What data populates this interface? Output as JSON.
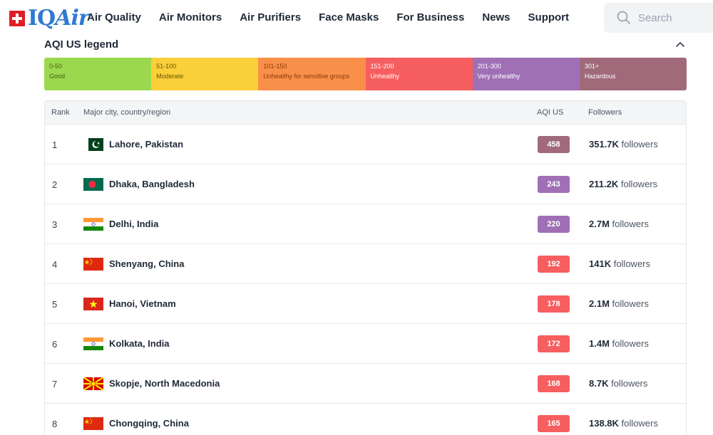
{
  "brand": {
    "name": "IQAir",
    "name_plain": "IQ",
    "name_italic": "Air"
  },
  "nav": [
    {
      "label": "Air Quality"
    },
    {
      "label": "Air Monitors"
    },
    {
      "label": "Air Purifiers"
    },
    {
      "label": "Face Masks"
    },
    {
      "label": "For Business"
    },
    {
      "label": "News"
    },
    {
      "label": "Support"
    }
  ],
  "search": {
    "placeholder": "Search"
  },
  "legend": {
    "title": "AQI US legend",
    "segments": [
      {
        "range": "0-50",
        "label": "Good",
        "color": "#9cd84e",
        "text_color": "#3f5d12"
      },
      {
        "range": "51-100",
        "label": "Moderate",
        "color": "#facf39",
        "text_color": "#6b5406"
      },
      {
        "range": "101-150",
        "label": "Unhealthy for sensitive groups",
        "color": "#f99049",
        "text_color": "#8a3a07"
      },
      {
        "range": "151-200",
        "label": "Unhealthy",
        "color": "#f65e5f",
        "text_color": "#ffffff"
      },
      {
        "range": "201-300",
        "label": "Very unhealthy",
        "color": "#a070b6",
        "text_color": "#ffffff"
      },
      {
        "range": "301+",
        "label": "Hazardous",
        "color": "#a06a7b",
        "text_color": "#ffffff"
      }
    ]
  },
  "table": {
    "headers": {
      "rank": "Rank",
      "city": "Major city, country/region",
      "aqi": "AQI US",
      "followers": "Followers"
    },
    "rows": [
      {
        "rank": "1",
        "city": "Lahore, Pakistan",
        "flag": "pakistan",
        "aqi": "458",
        "aqi_color": "#a06a7b",
        "followers": "351.7K",
        "followers_suffix": "followers"
      },
      {
        "rank": "2",
        "city": "Dhaka, Bangladesh",
        "flag": "bangladesh",
        "aqi": "243",
        "aqi_color": "#a070b6",
        "followers": "211.2K",
        "followers_suffix": "followers"
      },
      {
        "rank": "3",
        "city": "Delhi, India",
        "flag": "india",
        "aqi": "220",
        "aqi_color": "#a070b6",
        "followers": "2.7M",
        "followers_suffix": "followers"
      },
      {
        "rank": "4",
        "city": "Shenyang, China",
        "flag": "china",
        "aqi": "192",
        "aqi_color": "#f65e5f",
        "followers": "141K",
        "followers_suffix": "followers"
      },
      {
        "rank": "5",
        "city": "Hanoi, Vietnam",
        "flag": "vietnam",
        "aqi": "178",
        "aqi_color": "#f65e5f",
        "followers": "2.1M",
        "followers_suffix": "followers"
      },
      {
        "rank": "6",
        "city": "Kolkata, India",
        "flag": "india",
        "aqi": "172",
        "aqi_color": "#f65e5f",
        "followers": "1.4M",
        "followers_suffix": "followers"
      },
      {
        "rank": "7",
        "city": "Skopje, North Macedonia",
        "flag": "north-macedonia",
        "aqi": "168",
        "aqi_color": "#f65e5f",
        "followers": "8.7K",
        "followers_suffix": "followers"
      },
      {
        "rank": "8",
        "city": "Chongqing, China",
        "flag": "china",
        "aqi": "165",
        "aqi_color": "#f65e5f",
        "followers": "138.8K",
        "followers_suffix": "followers"
      }
    ]
  }
}
